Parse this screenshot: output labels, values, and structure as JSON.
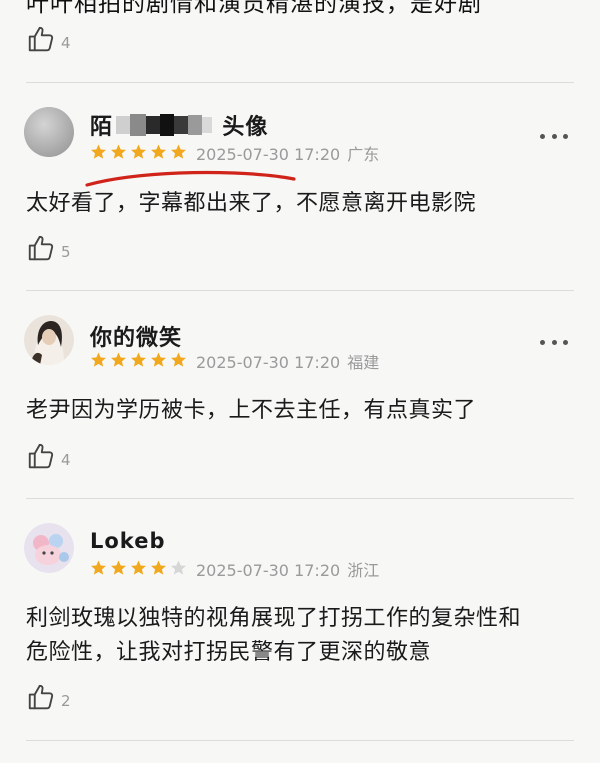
{
  "top_partial": {
    "text_fragment": "叶叶相拍的剧情和演员精湛的演技，是好剧",
    "likes": "4"
  },
  "comments": [
    {
      "username_start": "陌",
      "username_end": "头像",
      "stars": 5,
      "time": "2025-07-30 17:20",
      "location": "广东",
      "text": "太好看了，字幕都出来了，不愿意离开电影院",
      "likes": "5"
    },
    {
      "username": "你的微笑",
      "stars": 5,
      "time": "2025-07-30 17:20",
      "location": "福建",
      "text": "老尹因为学历被卡，上不去主任，有点真实了",
      "likes": "4"
    },
    {
      "username": "Lokeb",
      "stars": 4,
      "time": "2025-07-30 17:20",
      "location": "浙江",
      "text_line1": "利剑玫瑰以独特的视角展现了打拐工作的复杂性和",
      "text_line2": "危险性，让我对打拐民警有了更深的敬意",
      "likes": "2"
    }
  ],
  "colors": {
    "star_filled": "#f2a81d",
    "star_empty": "#d6d6d6",
    "annotation_red": "#d0241b",
    "meta_gray": "#9a9a9a"
  },
  "icons": [
    "thumbs-up-icon",
    "more-icon",
    "star-icon"
  ]
}
